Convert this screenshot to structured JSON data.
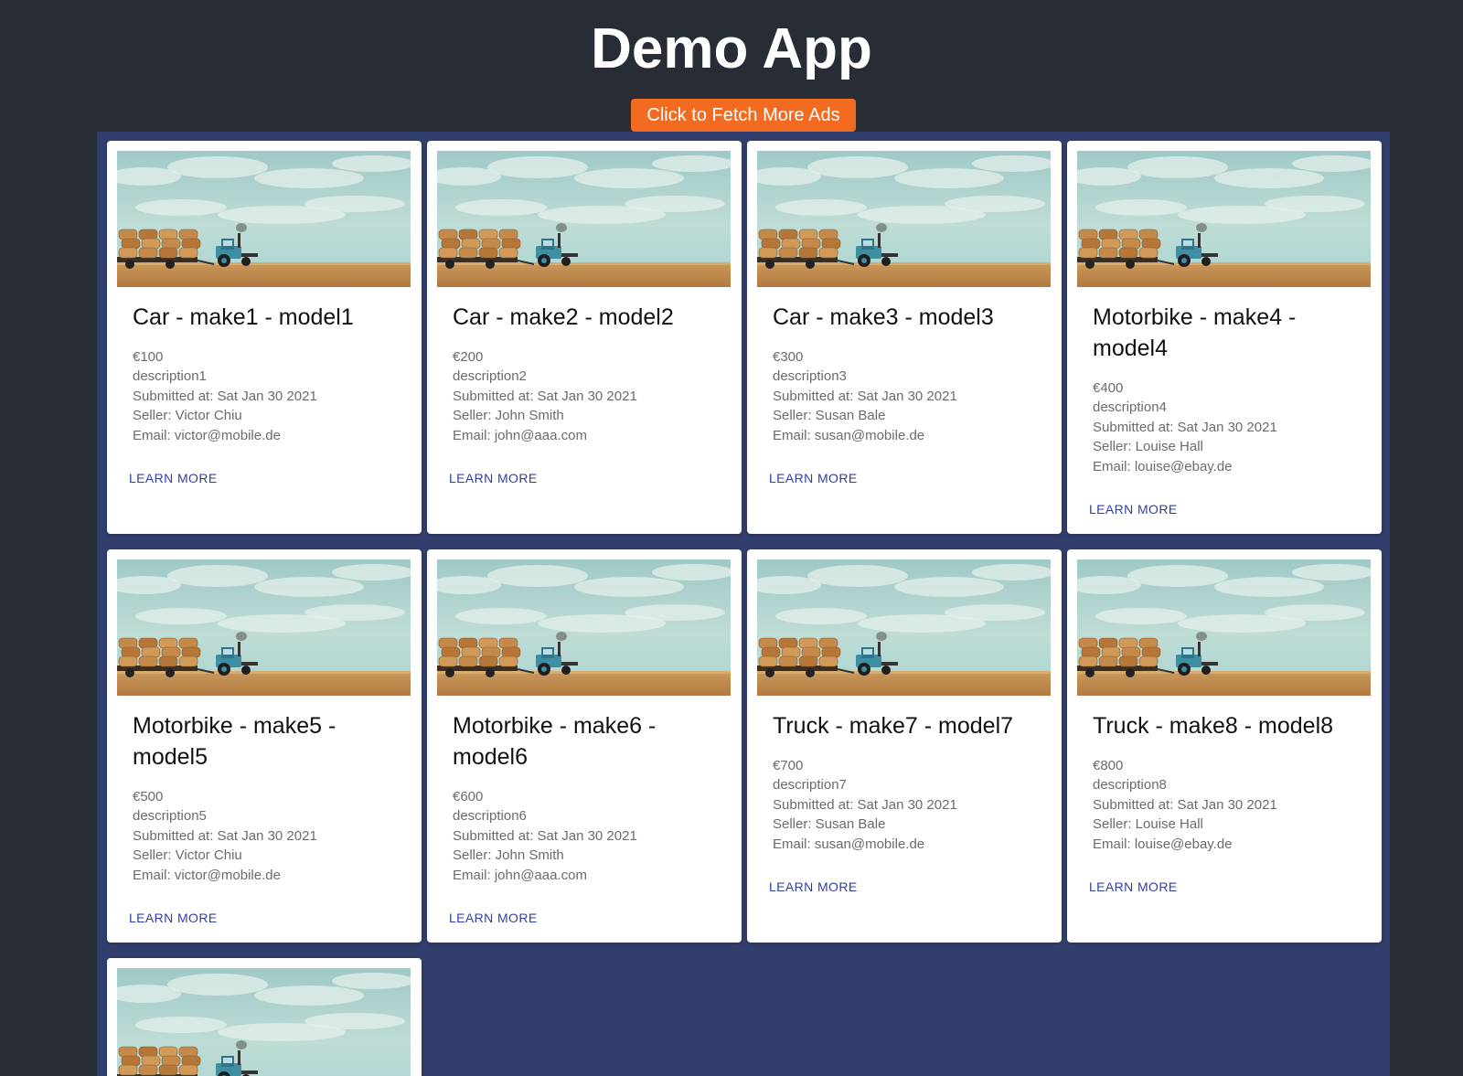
{
  "app": {
    "title": "Demo App",
    "fetch_button_label": "Click to Fetch More Ads"
  },
  "colors": {
    "page_background": "#282c34",
    "grid_background": "#323e6e",
    "button_background": "#f26b21",
    "link": "#2f3ea8"
  },
  "ads": [
    {
      "title": "Car - make1 - model1",
      "price": "€100",
      "description": "description1",
      "submitted": "Submitted at: Sat Jan 30 2021",
      "seller": "Seller: Victor Chiu",
      "email": "Email: victor@mobile.de",
      "action_label": "Learn More"
    },
    {
      "title": "Car - make2 - model2",
      "price": "€200",
      "description": "description2",
      "submitted": "Submitted at: Sat Jan 30 2021",
      "seller": "Seller: John Smith",
      "email": "Email: john@aaa.com",
      "action_label": "Learn More"
    },
    {
      "title": "Car - make3 - model3",
      "price": "€300",
      "description": "description3",
      "submitted": "Submitted at: Sat Jan 30 2021",
      "seller": "Seller: Susan Bale",
      "email": "Email: susan@mobile.de",
      "action_label": "Learn More"
    },
    {
      "title": "Motorbike - make4 - model4",
      "price": "€400",
      "description": "description4",
      "submitted": "Submitted at: Sat Jan 30 2021",
      "seller": "Seller: Louise Hall",
      "email": "Email: louise@ebay.de",
      "action_label": "Learn More"
    },
    {
      "title": "Motorbike - make5 - model5",
      "price": "€500",
      "description": "description5",
      "submitted": "Submitted at: Sat Jan 30 2021",
      "seller": "Seller: Victor Chiu",
      "email": "Email: victor@mobile.de",
      "action_label": "Learn More"
    },
    {
      "title": "Motorbike - make6 - model6",
      "price": "€600",
      "description": "description6",
      "submitted": "Submitted at: Sat Jan 30 2021",
      "seller": "Seller: John Smith",
      "email": "Email: john@aaa.com",
      "action_label": "Learn More"
    },
    {
      "title": "Truck - make7 - model7",
      "price": "€700",
      "description": "description7",
      "submitted": "Submitted at: Sat Jan 30 2021",
      "seller": "Seller: Susan Bale",
      "email": "Email: susan@mobile.de",
      "action_label": "Learn More"
    },
    {
      "title": "Truck - make8 - model8",
      "price": "€800",
      "description": "description8",
      "submitted": "Submitted at: Sat Jan 30 2021",
      "seller": "Seller: Louise Hall",
      "email": "Email: louise@ebay.de",
      "action_label": "Learn More"
    }
  ]
}
